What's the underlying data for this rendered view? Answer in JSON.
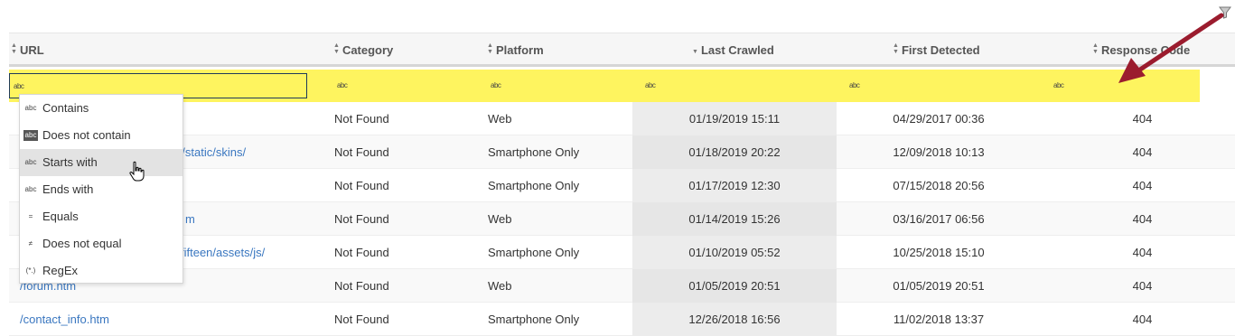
{
  "filter_toggle_icon": "funnel-icon",
  "columns": [
    {
      "key": "url",
      "label": "URL",
      "sort": "unsorted"
    },
    {
      "key": "category",
      "label": "Category",
      "sort": "unsorted"
    },
    {
      "key": "platform",
      "label": "Platform",
      "sort": "unsorted"
    },
    {
      "key": "last_crawled",
      "label": "Last Crawled",
      "sort": "descending"
    },
    {
      "key": "first_detected",
      "label": "First Detected",
      "sort": "unsorted"
    },
    {
      "key": "response_code",
      "label": "Response Code",
      "sort": "unsorted"
    }
  ],
  "filter_icon_text": "abc",
  "filter_operators": [
    {
      "label": "Contains",
      "icon": "abc"
    },
    {
      "label": "Does not contain",
      "icon": "abc"
    },
    {
      "label": "Starts with",
      "icon": "abc"
    },
    {
      "label": "Ends with",
      "icon": "abc"
    },
    {
      "label": "Equals",
      "icon": "="
    },
    {
      "label": "Does not equal",
      "icon": "≠"
    },
    {
      "label": "RegEx",
      "icon": "(*.)"
    }
  ],
  "hovered_operator": "Starts with",
  "rows": [
    {
      "url": "",
      "category": "Not Found",
      "platform": "Web",
      "last_crawled": "01/19/2019 15:11",
      "first_detected": "04/29/2017 00:36",
      "response_code": "404"
    },
    {
      "url": "der/static/skins/",
      "category": "Not Found",
      "platform": "Smartphone Only",
      "last_crawled": "01/18/2019 20:22",
      "first_detected": "12/09/2018 10:13",
      "response_code": "404"
    },
    {
      "url": "",
      "category": "Not Found",
      "platform": "Smartphone Only",
      "last_crawled": "01/17/2019 12:30",
      "first_detected": "07/15/2018 20:56",
      "response_code": "404"
    },
    {
      "url": "m",
      "category": "Not Found",
      "platform": "Web",
      "last_crawled": "01/14/2019 15:26",
      "first_detected": "03/16/2017 06:56",
      "response_code": "404"
    },
    {
      "url": "fifteen/assets/js/",
      "category": "Not Found",
      "platform": "Smartphone Only",
      "last_crawled": "01/10/2019 05:52",
      "first_detected": "10/25/2018 15:10",
      "response_code": "404"
    },
    {
      "url": "/forum.htm",
      "category": "Not Found",
      "platform": "Web",
      "last_crawled": "01/05/2019 20:51",
      "first_detected": "01/05/2019 20:51",
      "response_code": "404"
    },
    {
      "url": "/contact_info.htm",
      "category": "Not Found",
      "platform": "Smartphone Only",
      "last_crawled": "12/26/2018 16:56",
      "first_detected": "11/02/2018 13:37",
      "response_code": "404"
    }
  ],
  "colors": {
    "filter_row": "#fef45f",
    "link": "#3a77c0",
    "annotation_arrow": "#9b1c2e"
  }
}
